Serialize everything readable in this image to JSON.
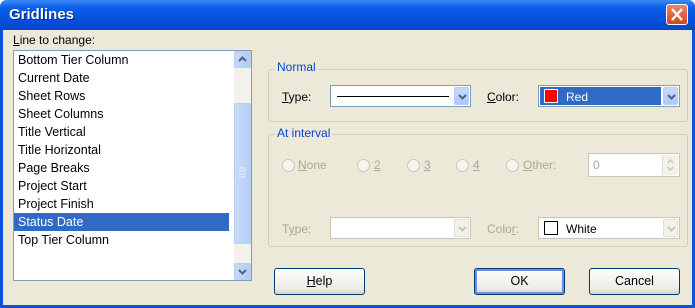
{
  "window": {
    "title": "Gridlines"
  },
  "list": {
    "label": "Line to change:",
    "items": [
      "Bottom Tier Column",
      "Current Date",
      "Sheet Rows",
      "Sheet Columns",
      "Title Vertical",
      "Title Horizontal",
      "Page Breaks",
      "Project Start",
      "Project Finish",
      "Status Date",
      "Top Tier Column"
    ],
    "selected": "Status Date"
  },
  "normal": {
    "title": "Normal",
    "type_label": "Type:",
    "color_label": "Color:",
    "color_value": "Red",
    "color_hex": "#ff0000"
  },
  "interval": {
    "title": "At interval",
    "options": [
      "None",
      "2",
      "3",
      "4",
      "Other:"
    ],
    "other_value": "0",
    "type_label": "Type:",
    "color_label": "Color:",
    "color_value": "White",
    "color_hex": "#ffffff"
  },
  "buttons": {
    "help": "Help",
    "ok": "OK",
    "cancel": "Cancel"
  }
}
